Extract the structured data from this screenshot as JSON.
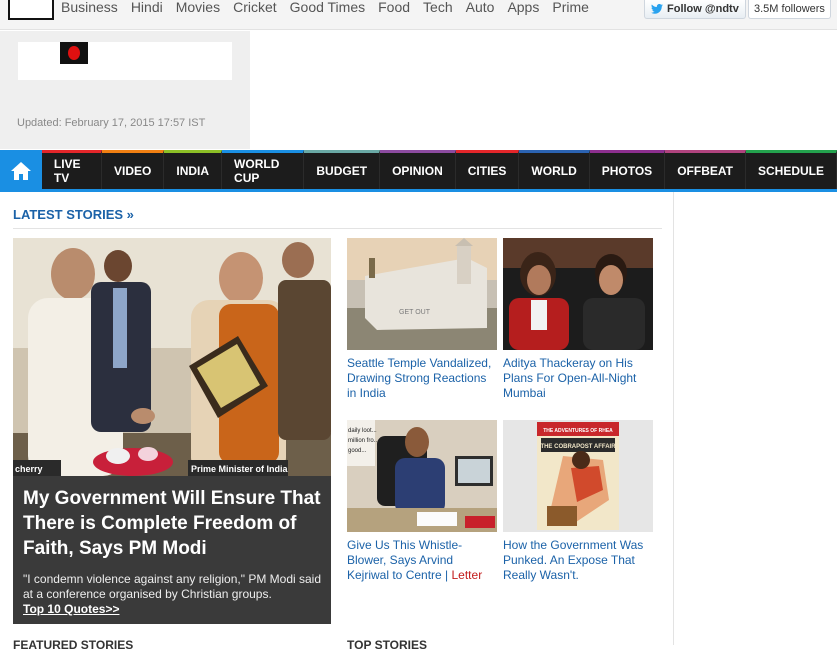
{
  "topbar": {
    "nav": [
      "Business",
      "Hindi",
      "Movies",
      "Cricket",
      "Good Times",
      "Food",
      "Tech",
      "Auto",
      "Apps",
      "Prime"
    ],
    "follow_label": "Follow @ndtv",
    "followers": "3.5M followers"
  },
  "header": {
    "updated": "Updated: February 17, 2015 17:57 IST"
  },
  "nav": {
    "items": [
      {
        "label": "LIVE TV",
        "color": "#e4262a"
      },
      {
        "label": "VIDEO",
        "color": "#f07f12"
      },
      {
        "label": "INDIA",
        "color": "#8cbf26"
      },
      {
        "label": "WORLD CUP",
        "color": "#1a8fe3"
      },
      {
        "label": "BUDGET",
        "color": "#6aa9a5"
      },
      {
        "label": "OPINION",
        "color": "#8c4ba0"
      },
      {
        "label": "CITIES",
        "color": "#e4262a"
      },
      {
        "label": "WORLD",
        "color": "#2b63b2"
      },
      {
        "label": "PHOTOS",
        "color": "#8d2f8f"
      },
      {
        "label": "OFFBEAT",
        "color": "#b0437e"
      },
      {
        "label": "SCHEDULE",
        "color": "#23a24d"
      }
    ]
  },
  "main": {
    "section_title": "LATEST STORIES »",
    "lead": {
      "headline": "My Government Will Ensure That There is Complete Freedom of Faith, Says PM Modi",
      "summary": "\"I condemn violence against any religion,\" PM Modi said at a conference organised by Christian groups.",
      "more": "Top 10 Quotes>>",
      "img_text_left": "cherry",
      "img_text_right": "Prime Minister of India"
    },
    "cards": [
      {
        "caption": "Seattle Temple Vandalized, Drawing Strong Reactions in India",
        "tag": ""
      },
      {
        "caption": "Aditya Thackeray on His Plans For Open-All-Night Mumbai",
        "tag": ""
      },
      {
        "caption": "Give Us This Whistle-Blower, Says Arvind Kejriwal to Centre | ",
        "tag": "Letter"
      },
      {
        "caption": "How the Government Was Punked. An Expose That Really Wasn't.",
        "tag": ""
      }
    ],
    "comic": {
      "top": "THE ADVENTURES OF RHEA",
      "title": "THE COBRAPOST AFFAIR"
    },
    "bottom_left": "FEATURED STORIES",
    "bottom_right": "TOP STORIES"
  }
}
